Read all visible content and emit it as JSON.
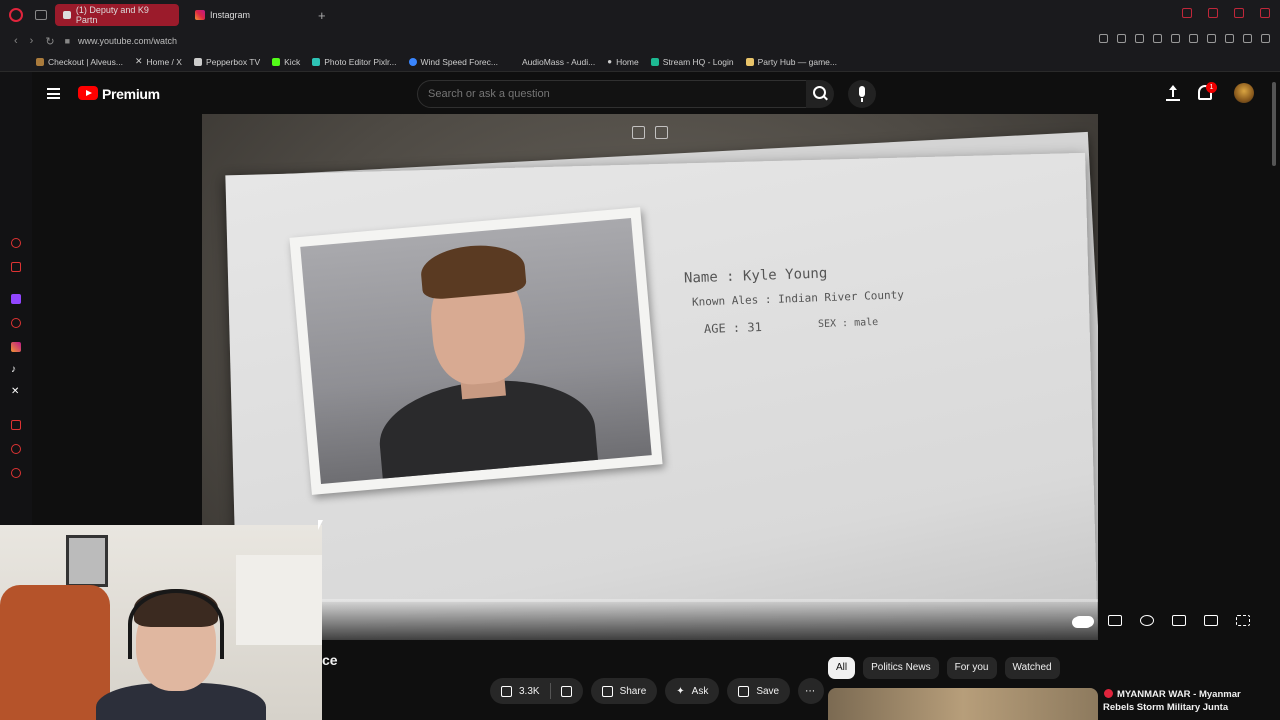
{
  "browser": {
    "tabs": [
      {
        "label": "(1) Deputy and K9 Partn",
        "active": true
      },
      {
        "label": "Instagram",
        "active": false
      }
    ],
    "url": "www.youtube.com/watch",
    "bookmarks": [
      "Checkout | Alveus...",
      "Home / X",
      "Pepperbox TV",
      "Kick",
      "Photo Editor Pixlr...",
      "Wind Speed Forec...",
      "AudioMass - Audi...",
      "Home",
      "Stream HQ - Login",
      "Party Hub — game..."
    ]
  },
  "header": {
    "brand": "Premium",
    "search_placeholder": "Search or ask a question",
    "notification_count": "1"
  },
  "video": {
    "document": {
      "name_line": "Name : Kyle Young",
      "alias_line": "Known Ales :  Indian River County",
      "age_line": "AGE : 31",
      "sex_line": "SEX : male"
    }
  },
  "below": {
    "title_fragment": "ce",
    "actions": {
      "likes": "3.3K",
      "share": "Share",
      "ask": "Ask",
      "save": "Save"
    },
    "chips": [
      "All",
      "Politics News",
      "For you",
      "Watched"
    ],
    "recommendation": {
      "title": "MYANMAR WAR - Myanmar Rebels Storm Military Junta"
    }
  },
  "colors": {
    "accent": "#ff0000",
    "opera": "#e0243c",
    "background": "#0f0f0f"
  }
}
